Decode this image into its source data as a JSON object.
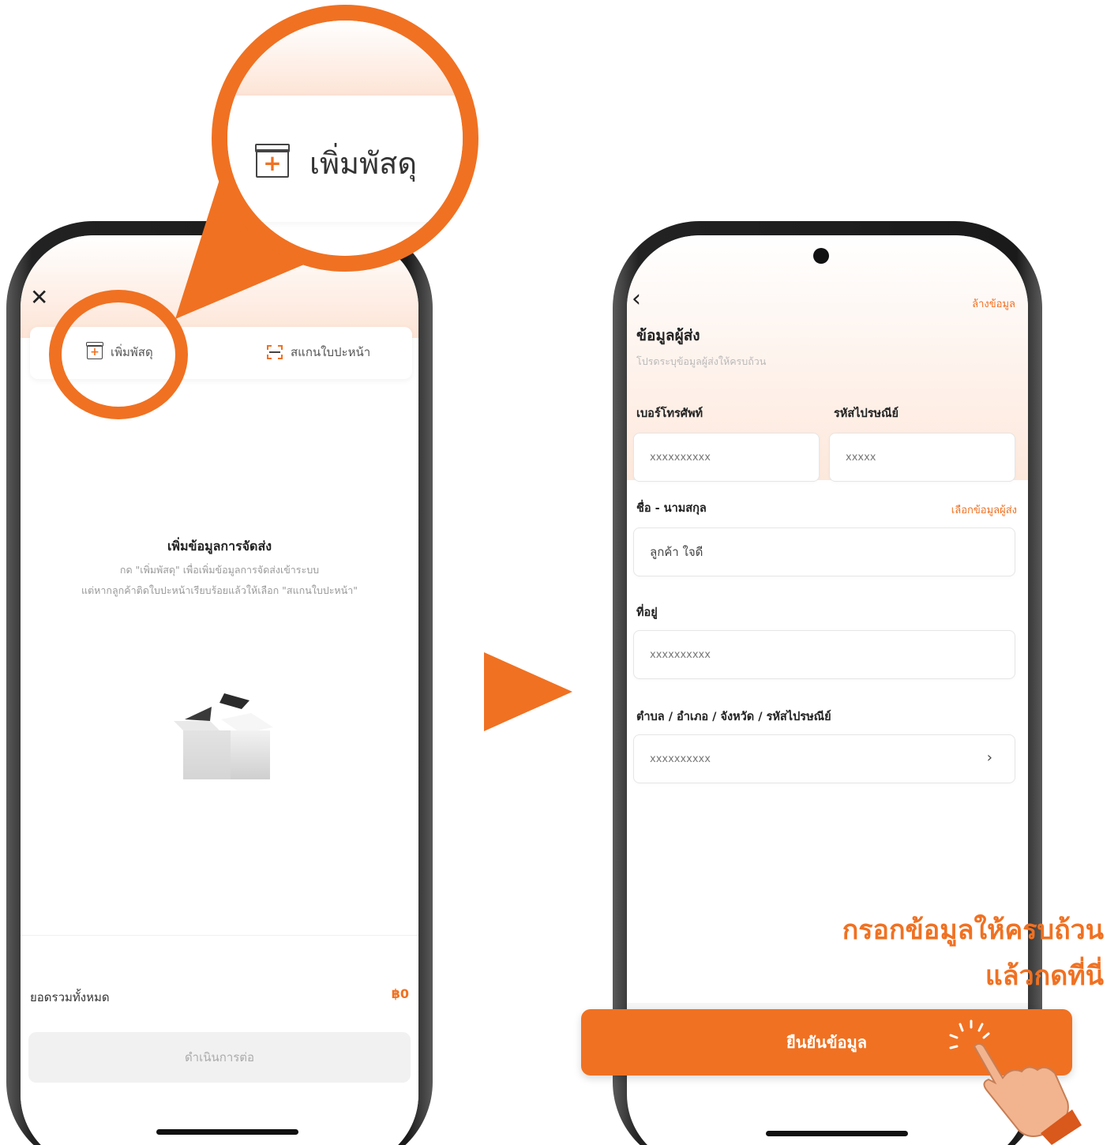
{
  "colors": {
    "accent": "#f07122",
    "gradient_top": "#fde4d6"
  },
  "left_screen": {
    "close_icon": "close-icon",
    "tabs": [
      {
        "label": "เพิ่มพัสดุ",
        "icon": "box-plus-icon"
      },
      {
        "label": "สแกนใบปะหน้า",
        "icon": "scan-icon"
      }
    ],
    "empty_state": {
      "title": "เพิ่มข้อมูลการจัดส่ง",
      "line1": "กด \"เพิ่มพัสดุ\" เพื่อเพิ่มข้อมูลการจัดส่งเข้าระบบ",
      "line2": "แต่หากลูกค้าติดใบปะหน้าเรียบร้อยแล้วให้เลือก \"สแกนใบปะหน้า\"",
      "illustration": "open-box-icon"
    },
    "total_label": "ยอดรวมทั้งหมด",
    "total_value": "฿0",
    "continue_label": "ดำเนินการต่อ"
  },
  "zoom": {
    "label": "เพิ่มพัสดุ",
    "icon": "box-plus-icon"
  },
  "right_screen": {
    "back_icon": "chevron-left-icon",
    "clear_label": "ล้างข้อมูล",
    "title": "ข้อมูลผู้ส่ง",
    "subtitle": "โปรดระบุข้อมูลผู้ส่งให้ครบถ้วน",
    "phone_label": "เบอร์โทรศัพท์",
    "phone_value": "xxxxxxxxxx",
    "postal_label": "รหัสไปรษณีย์",
    "postal_value": "xxxxx",
    "name_label": "ชื่อ - นามสกุล",
    "select_sender_label": "เลือกข้อมูลผู้ส่ง",
    "name_value": "ลูกค้า ใจดี",
    "address_label": "ที่อยู่",
    "address_value": "xxxxxxxxxx",
    "district_label": "ตำบล / อำเภอ / จังหวัด / รหัสไปรษณีย์",
    "district_value": "xxxxxxxxxx"
  },
  "caption": {
    "line1": "กรอกข้อมูลให้ครบถ้วน",
    "line2": "แล้วกดที่นี่"
  },
  "confirm_label": "ยืนยันข้อมูล"
}
